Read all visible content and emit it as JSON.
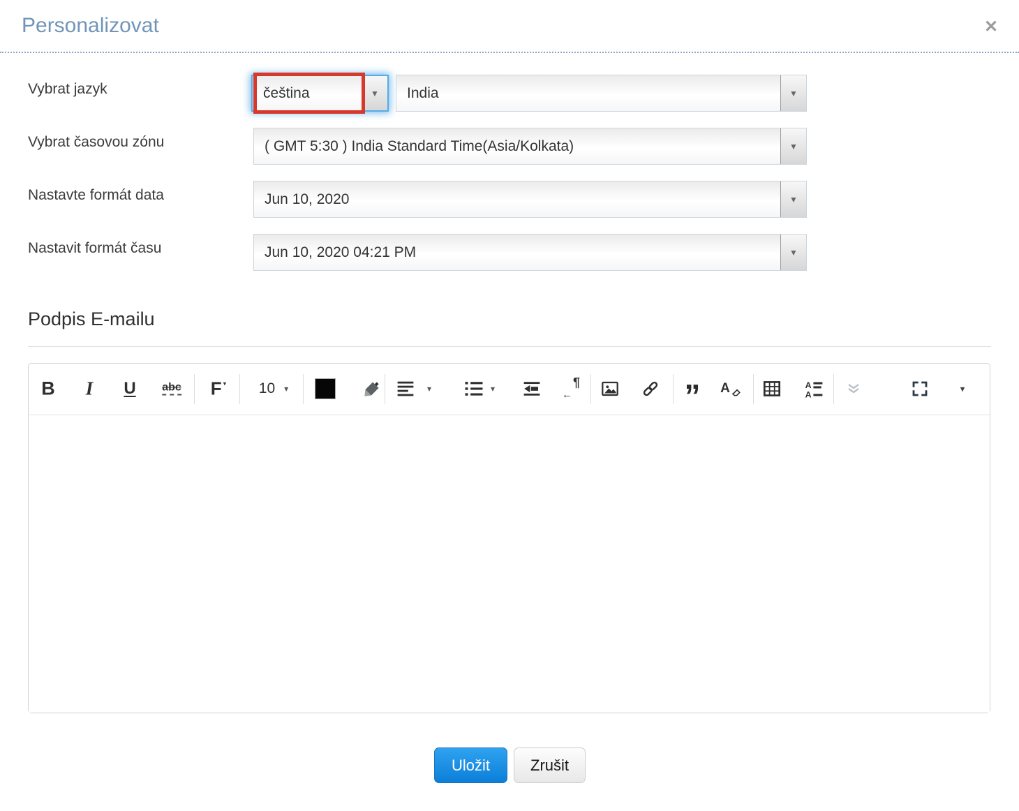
{
  "header": {
    "title": "Personalizovat"
  },
  "icons": {
    "close": "✕",
    "select_caret": "▼",
    "caret_down": "▾",
    "double_quote": "”",
    "pilcrow": "¶",
    "arrow_left": "←"
  },
  "form": {
    "language": {
      "label": "Vybrat jazyk",
      "value": "čeština",
      "region_value": "India"
    },
    "timezone": {
      "label": "Vybrat časovou zónu",
      "value": "( GMT 5:30 ) India Standard Time(Asia/Kolkata)"
    },
    "date_format": {
      "label": "Nastavte formát data",
      "value": "Jun 10, 2020"
    },
    "time_format": {
      "label": "Nastavit formát času",
      "value": "Jun 10, 2020 04:21 PM"
    }
  },
  "signature": {
    "heading": "Podpis E-mailu",
    "content": ""
  },
  "toolbar": {
    "bold": "B",
    "italic": "I",
    "underline": "U",
    "strikethrough": "abc",
    "font_family": "F",
    "font_size": "10",
    "clear_format": "A"
  },
  "buttons": {
    "save": "Uložit",
    "cancel": "Zrušit"
  },
  "colors": {
    "title_blue": "#7195b8",
    "focus_blue": "#55ace5",
    "annotation_red": "#d6382c",
    "save_blue_top": "#30a2f0",
    "save_blue_bottom": "#0b7fd9"
  }
}
